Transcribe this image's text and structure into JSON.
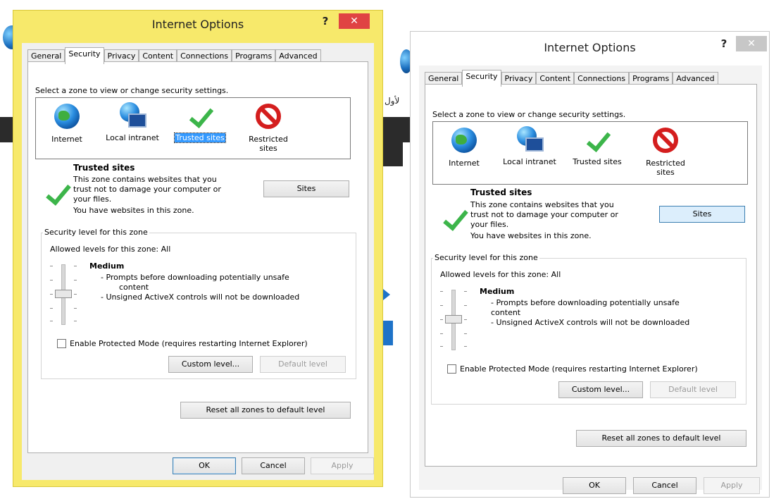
{
  "dialog": {
    "title": "Internet Options",
    "help": "?",
    "close": "✕",
    "tabs": [
      "General",
      "Security",
      "Privacy",
      "Content",
      "Connections",
      "Programs",
      "Advanced"
    ],
    "zone_prompt": "Select a zone to view or change security settings.",
    "zones": [
      "Internet",
      "Local intranet",
      "Trusted sites",
      "Restricted sites"
    ],
    "zone_title": "Trusted sites",
    "zone_desc_1": "This zone contains websites that you",
    "zone_desc_2": "trust not to damage your computer or",
    "zone_desc_3": "your files.",
    "zone_desc_4": "You have websites in this zone.",
    "sites_button": "Sites",
    "security_group": "Security level for this zone",
    "allowed_levels": "Allowed levels for this zone: All",
    "level_name": "Medium",
    "level_line_1": "- Prompts before downloading potentially unsafe",
    "level_line_2": "content",
    "level_line_3": "- Unsigned ActiveX controls will not be downloaded",
    "protected_mode": "Enable Protected Mode (requires restarting Internet Explorer)",
    "custom_level": "Custom level...",
    "default_level": "Default level",
    "reset_all": "Reset all zones to default level",
    "ok": "OK",
    "cancel": "Cancel",
    "apply": "Apply"
  },
  "background": {
    "arabic_fragment": "لأول"
  }
}
